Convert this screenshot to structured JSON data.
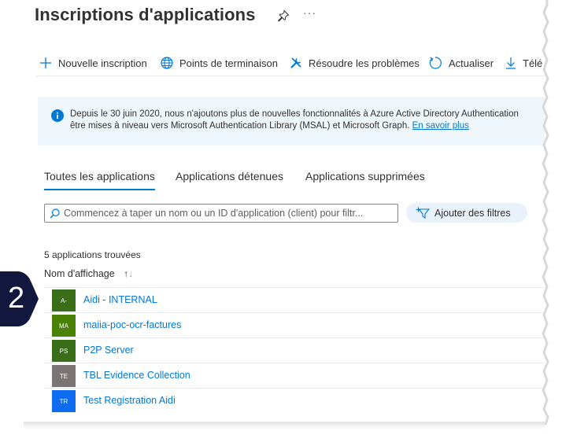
{
  "header": {
    "title": "Inscriptions d'applications",
    "more_label": "···"
  },
  "toolbar": {
    "new_registration": "Nouvelle inscription",
    "endpoints": "Points de terminaison",
    "troubleshoot": "Résoudre les problèmes",
    "refresh": "Actualiser",
    "download": "Télé"
  },
  "info_banner": {
    "line1": "Depuis le 30 juin 2020, nous n'ajoutons plus de nouvelles fonctionnalités à Azure Active Directory Authentication",
    "line2_prefix": "être mises à niveau vers Microsoft Authentication Library (MSAL) et Microsoft Graph. ",
    "link": "En savoir plus"
  },
  "tabs": [
    {
      "label": "Toutes les applications",
      "active": true
    },
    {
      "label": "Applications détenues",
      "active": false
    },
    {
      "label": "Applications supprimées",
      "active": false
    }
  ],
  "search": {
    "placeholder": "Commencez à taper un nom ou un ID d'application (client) pour filtr..."
  },
  "filter_button": "Ajouter des filtres",
  "results": {
    "count_text": "5 applications trouvées",
    "column_header": "Nom d'affichage",
    "rows": [
      {
        "initials": "A-",
        "name": "Aidi - INTERNAL",
        "color": "#3b6e18"
      },
      {
        "initials": "MA",
        "name": "maiia-poc-ocr-factures",
        "color": "#498205"
      },
      {
        "initials": "PS",
        "name": "P2P Server",
        "color": "#3b6e18"
      },
      {
        "initials": "TE",
        "name": "TBL Evidence Collection",
        "color": "#7a7574"
      },
      {
        "initials": "TR",
        "name": "Test Registration Aidi",
        "color": "#0f6cf0"
      }
    ]
  },
  "callout": {
    "number": "2",
    "color": "#12183d"
  },
  "colors": {
    "accent": "#0078d4",
    "banner_bg": "#eff6fc"
  }
}
